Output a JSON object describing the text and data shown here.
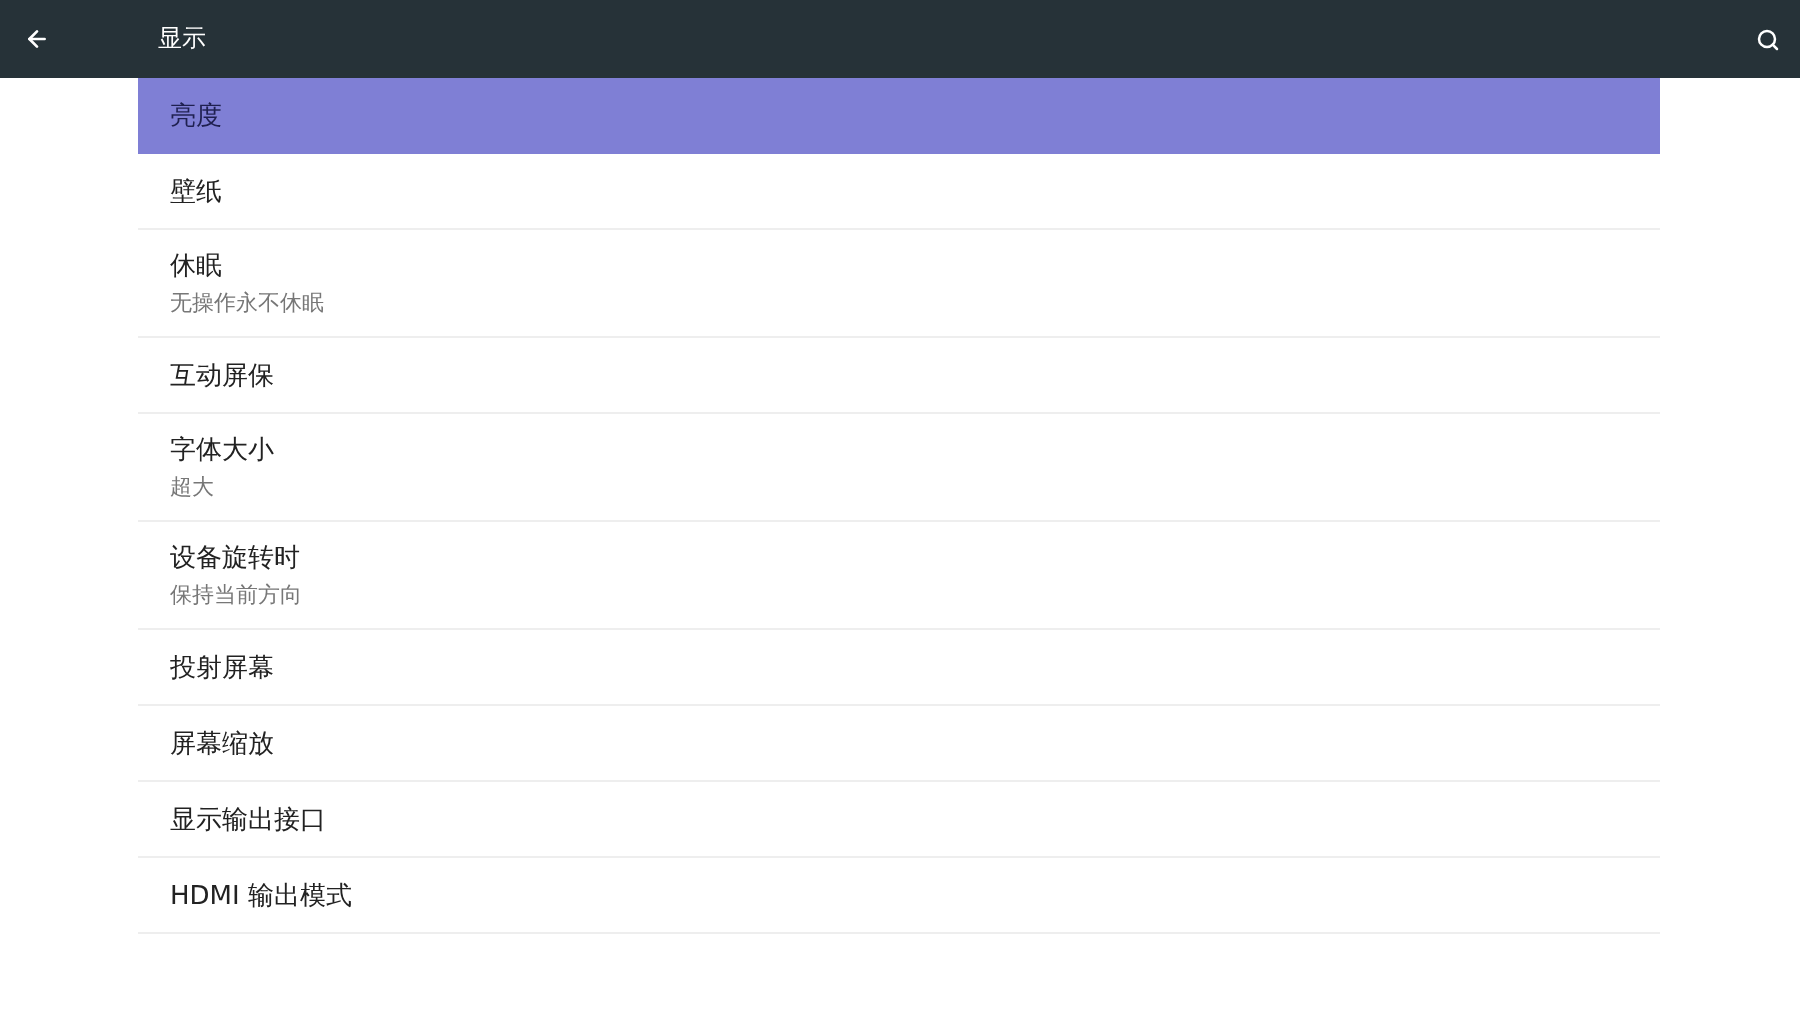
{
  "app_bar": {
    "title": "显示"
  },
  "items": [
    {
      "title": "亮度",
      "selected": true
    },
    {
      "title": "壁纸",
      "selected": false
    },
    {
      "title": "休眠",
      "summary": "无操作永不休眠",
      "selected": false
    },
    {
      "title": "互动屏保",
      "selected": false
    },
    {
      "title": "字体大小",
      "summary": "超大",
      "selected": false
    },
    {
      "title": "设备旋转时",
      "summary": "保持当前方向",
      "selected": false
    },
    {
      "title": "投射屏幕",
      "selected": false
    },
    {
      "title": "屏幕缩放",
      "selected": false
    },
    {
      "title": "显示输出接口",
      "selected": false
    },
    {
      "title": "HDMI 输出模式",
      "selected": false
    }
  ]
}
